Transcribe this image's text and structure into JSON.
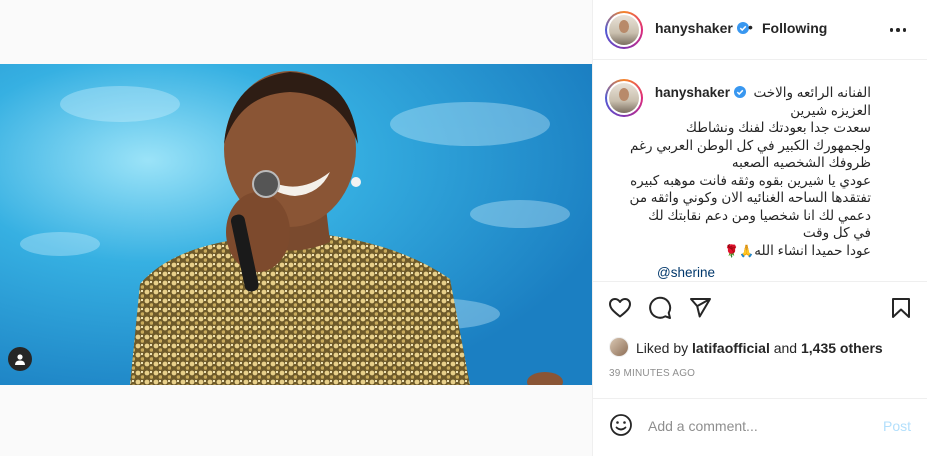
{
  "post": {
    "author": "hanyshaker",
    "follow_status": "Following",
    "separator": "•",
    "caption_lines": [
      "الفنانه الرائعه والاخت",
      "العزيزه شيرين",
      "سعدت جدا بعودتك لفنك ونشاطك",
      "ولجمهورك الكبير في كل الوطن العربي رغم",
      "ظروفك الشخصيه الصعبه",
      "عودي يا شيرين بقوه وثقه فانت موهبه كبيره",
      "تفتقدها الساحه الغنائيه الان وكوني واثقه من",
      "دعمي لك انا شخصيا ومن دعم نقابتك لك",
      "في كل وقت",
      "عودا حميدا انشاء الله"
    ],
    "caption_emojis": "🙏🌹",
    "mention": "@sherine",
    "liked_by_prefix": "Liked by",
    "liked_by_user": "latifaofficial",
    "liked_by_join": "and",
    "liked_by_others": "1,435 others",
    "timestamp": "39 MINUTES AGO"
  },
  "comment_box": {
    "placeholder": "Add a comment...",
    "post_label": "Post"
  },
  "icons": {
    "verified": "verified-badge-icon",
    "more": "more-options-icon",
    "like": "heart-icon",
    "comment": "comment-icon",
    "share": "paper-plane-icon",
    "save": "bookmark-icon",
    "emoji": "smiley-icon",
    "user_tags": "user-tag-icon"
  },
  "colors": {
    "verified_blue": "#3897f0",
    "post_button_disabled": "#b2dffc",
    "mention_link": "#00376b",
    "timestamp_gray": "#8e8e8e"
  }
}
